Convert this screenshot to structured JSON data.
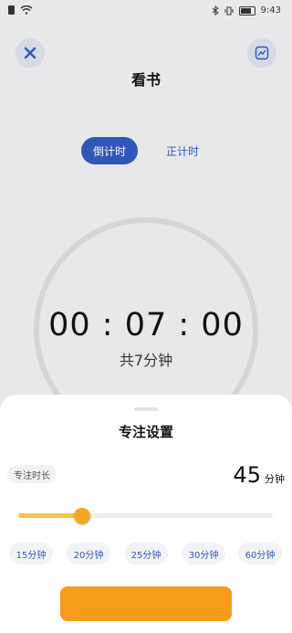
{
  "status_bar": {
    "time": "9:43",
    "left_icons": [
      "sim-icon",
      "wifi-icon"
    ],
    "right_icons": [
      "bluetooth-icon",
      "vibrate-icon",
      "battery-icon"
    ]
  },
  "header": {
    "title": "看书",
    "close_icon": "close-icon",
    "stats_icon": "chart-icon"
  },
  "mode_tabs": {
    "active": "倒计时",
    "inactive": "正计时"
  },
  "timer": {
    "display": "00 : 07 : 00",
    "total": "共7分钟"
  },
  "sheet": {
    "title": "专注设置",
    "duration_label": "专注时长",
    "duration_value": "45",
    "duration_unit": "分钟",
    "slider_level_percent": 25,
    "presets": [
      "15分钟",
      "20分钟",
      "25分钟",
      "30分钟",
      "60分钟"
    ]
  },
  "colors": {
    "accent_blue": "#2f57b8",
    "accent_orange": "#f5a623",
    "slider_fill": "#f8c247"
  }
}
